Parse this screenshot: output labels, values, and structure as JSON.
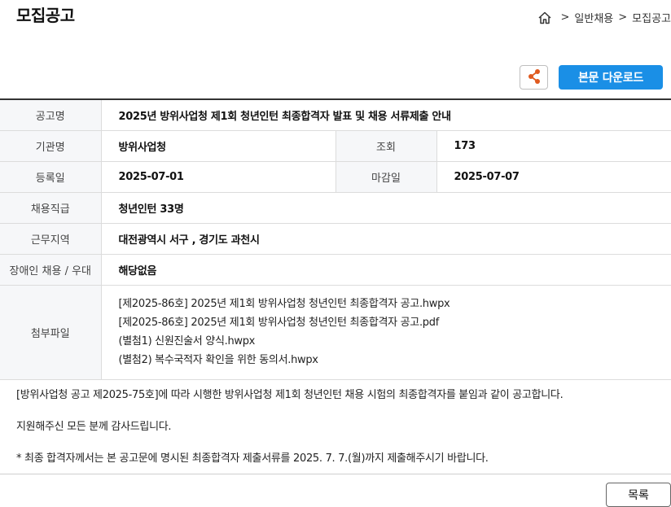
{
  "header": {
    "title": "모집공고",
    "breadcrumb": {
      "home_icon": "home-icon",
      "separator": ">",
      "items": [
        "일반채용",
        "모집공고"
      ]
    }
  },
  "actions": {
    "share_icon": "share-icon",
    "download_label": "본문 다운로드",
    "download_color": "#1a8fe6"
  },
  "details": {
    "notice_title_label": "공고명",
    "notice_title": "2025년 방위사업청 제1회 청년인턴 최종합격자 발표 및 채용 서류제출 안내",
    "agency_label": "기관명",
    "agency": "방위사업청",
    "views_label": "조회",
    "views": "173",
    "registered_label": "등록일",
    "registered": "2025-07-01",
    "deadline_label": "마감일",
    "deadline": "2025-07-07",
    "position_label": "채용직급",
    "position": "청년인턴 33명",
    "location_label": "근무지역",
    "location": "대전광역시 서구 , 경기도 과천시",
    "disability_label": "장애인 채용 / 우대",
    "disability": "해당없음",
    "attachments_label": "첨부파일",
    "attachments": [
      "[제2025-86호] 2025년 제1회 방위사업청 청년인턴 최종합격자 공고.hwpx",
      "[제2025-86호] 2025년 제1회 방위사업청 청년인턴 최종합격자 공고.pdf",
      "(별첨1) 신원진술서 양식.hwpx",
      "(별첨2) 복수국적자 확인을 위한 동의서.hwpx"
    ]
  },
  "body": {
    "paragraphs": [
      "[방위사업청 공고 제2025-75호]에 따라 시행한 방위사업청 제1회 청년인턴 채용 시험의 최종합격자를 붙임과 같이 공고합니다.",
      "지원해주신 모든 분께 감사드립니다.",
      "* 최종 합격자께서는 본 공고문에 명시된 최종합격자 제출서류를 2025. 7. 7.(월)까지 제출해주시기 바랍니다."
    ]
  },
  "footer": {
    "list_label": "목록"
  }
}
